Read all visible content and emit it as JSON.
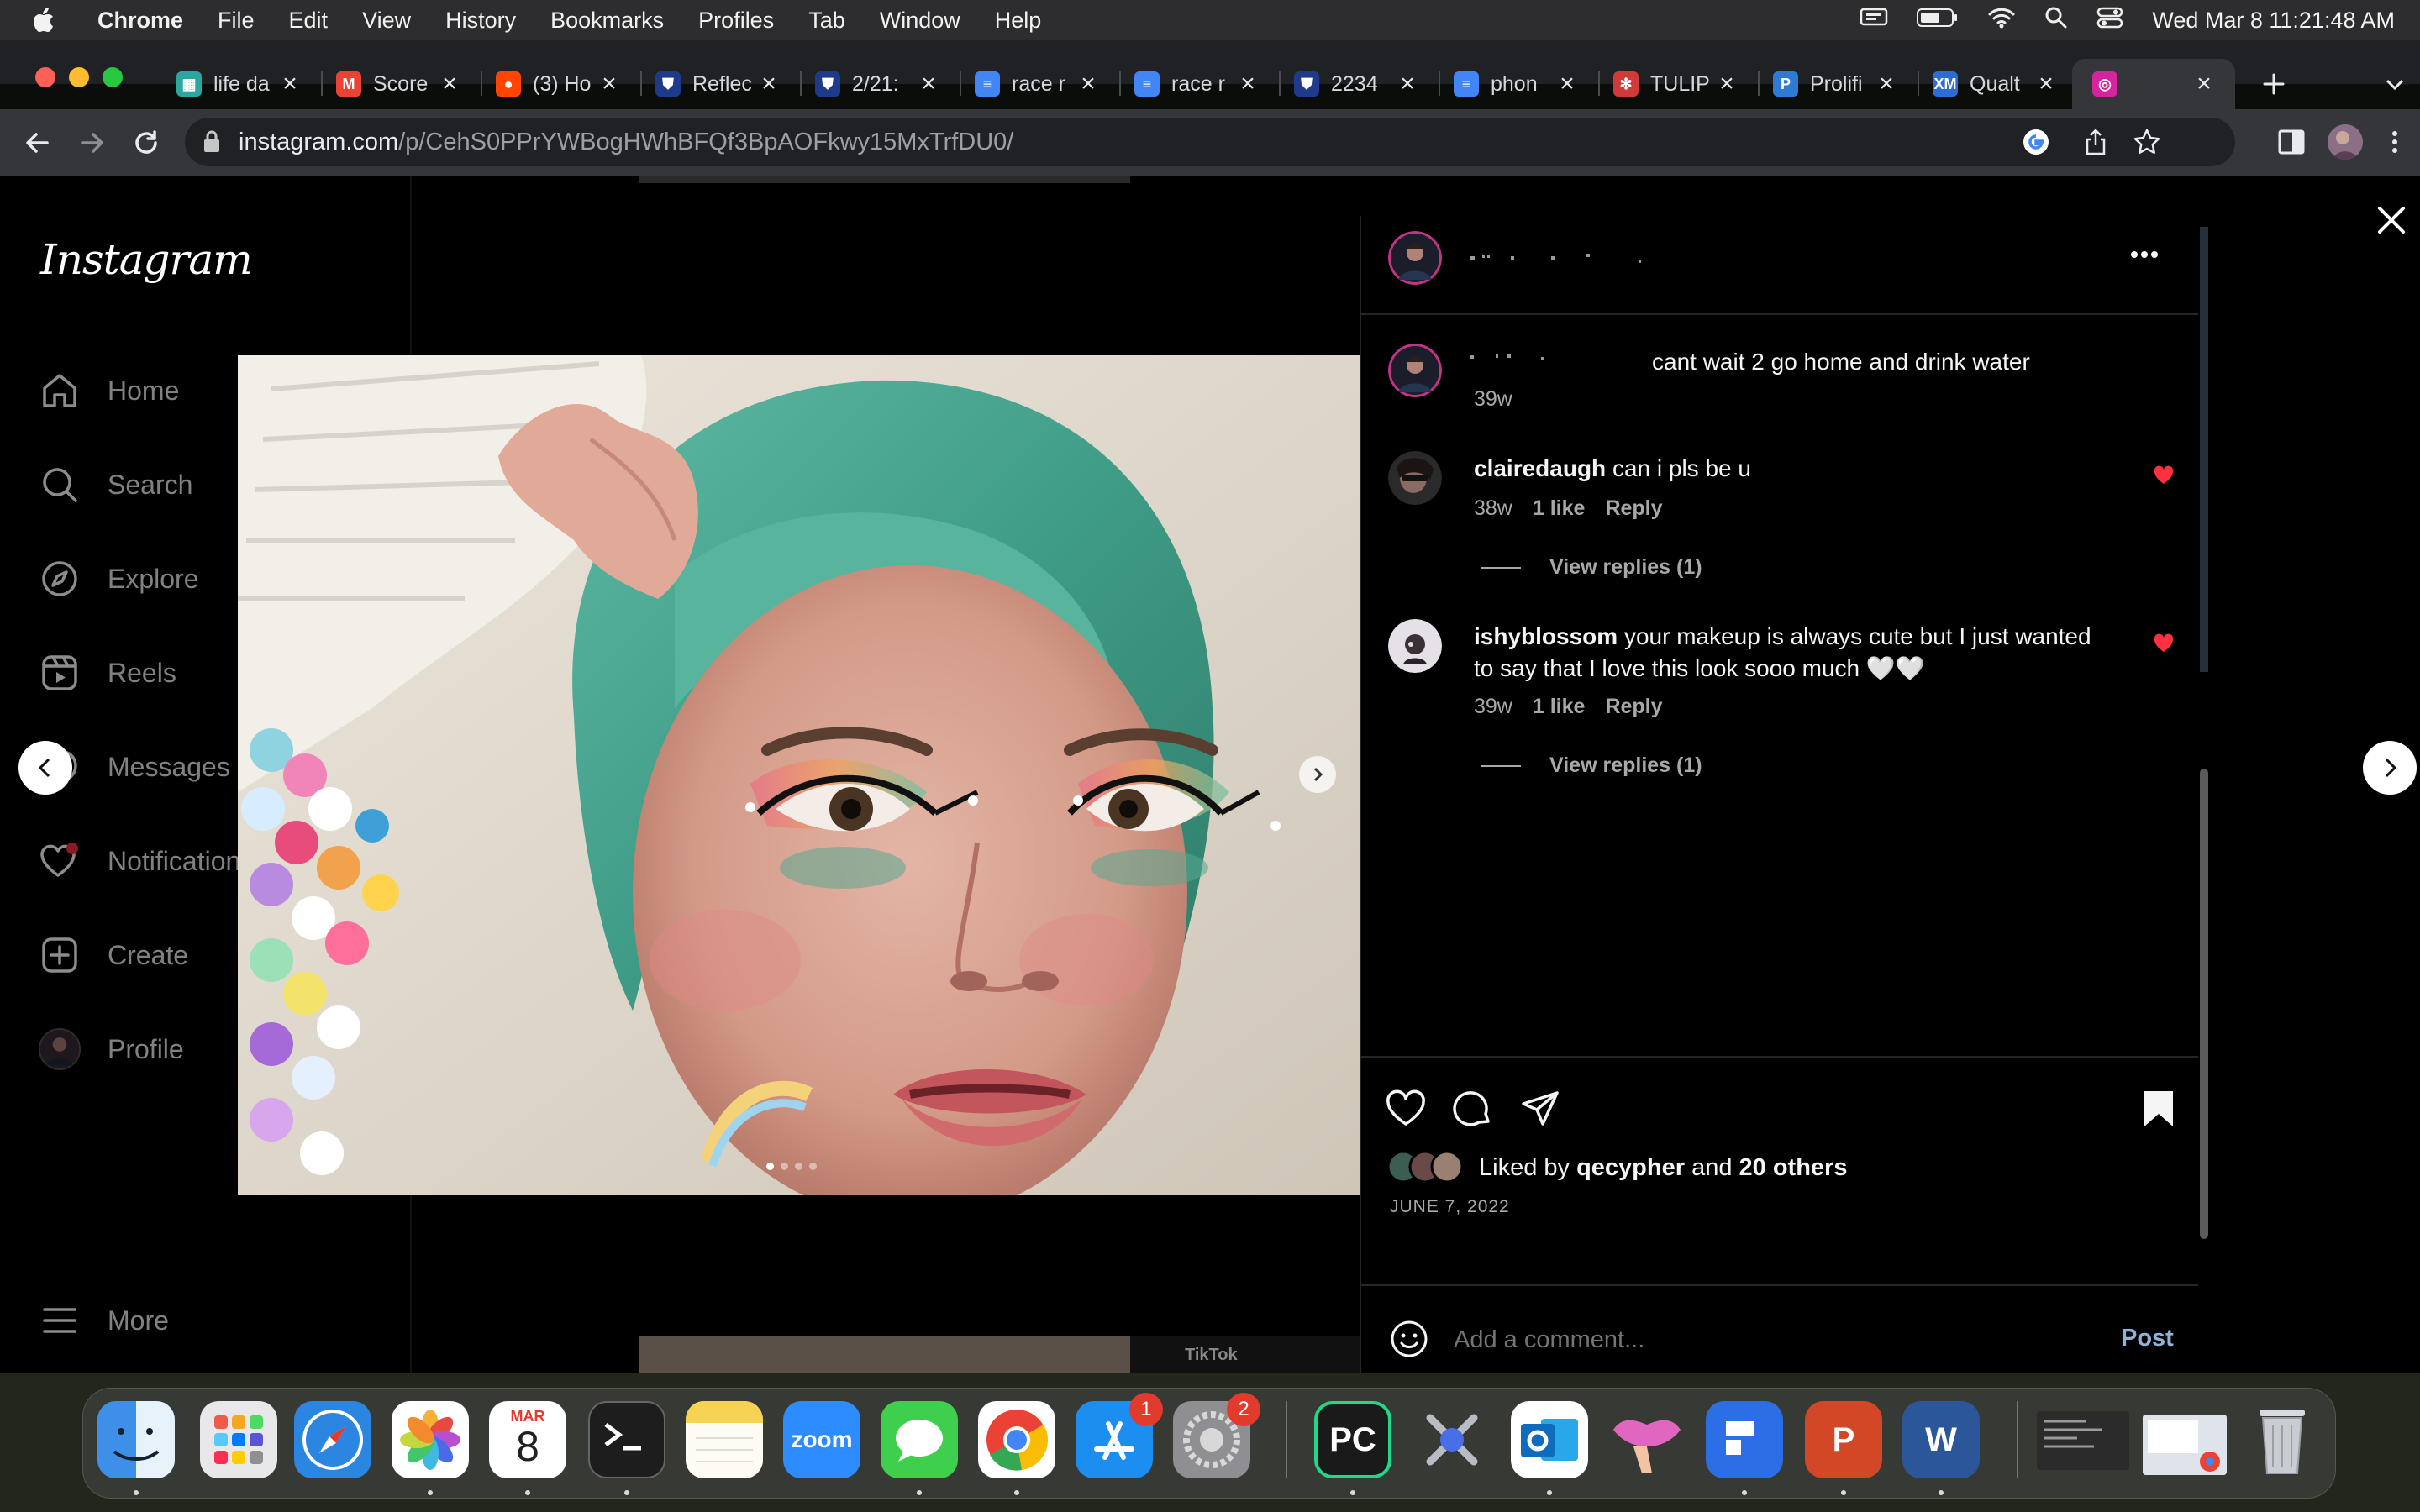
{
  "menubar": {
    "app": "Chrome",
    "items": [
      "File",
      "Edit",
      "View",
      "History",
      "Bookmarks",
      "Profiles",
      "Tab",
      "Window",
      "Help"
    ],
    "clock": "Wed Mar 8  11:21:48 AM"
  },
  "tabs": [
    {
      "label": "life da",
      "icon": "sheets-icon",
      "color": "#2aa8a0"
    },
    {
      "label": "Score",
      "icon": "gmail-icon",
      "color": "#ea4335"
    },
    {
      "label": "(3) Ho",
      "icon": "reddit-icon",
      "color": "#ff4500"
    },
    {
      "label": "Reflec",
      "icon": "shield-icon",
      "color": "#1f3a8a"
    },
    {
      "label": "2/21:",
      "icon": "shield-icon",
      "color": "#1f3a8a"
    },
    {
      "label": "race r",
      "icon": "docs-icon",
      "color": "#4285f4"
    },
    {
      "label": "race r",
      "icon": "docs-icon",
      "color": "#4285f4"
    },
    {
      "label": "2234",
      "icon": "shield-icon",
      "color": "#1f3a8a"
    },
    {
      "label": "phon",
      "icon": "docs-icon",
      "color": "#4285f4"
    },
    {
      "label": "TULIP",
      "icon": "tulip-icon",
      "color": "#d23a3a"
    },
    {
      "label": "Prolifi",
      "icon": "prolific-icon",
      "color": "#2e7bd6"
    },
    {
      "label": "Qualt",
      "icon": "qualtrics-icon",
      "color": "#2d6bd8"
    },
    {
      "label": "",
      "icon": "instagram-icon",
      "color": "#d6249f"
    }
  ],
  "address": {
    "host": "instagram.com",
    "path": "/p/CehS0PPrYWBogHWhBFQf3BpAOFkwy15MxTrfDU0/"
  },
  "instagram": {
    "logo": "Instagram",
    "nav": [
      {
        "label": "Home",
        "icon": "home-icon"
      },
      {
        "label": "Search",
        "icon": "search-icon"
      },
      {
        "label": "Explore",
        "icon": "explore-icon"
      },
      {
        "label": "Reels",
        "icon": "reels-icon"
      },
      {
        "label": "Messages",
        "icon": "messages-icon"
      },
      {
        "label": "Notifications",
        "icon": "heart-icon"
      },
      {
        "label": "Create",
        "icon": "create-icon"
      },
      {
        "label": "Profile",
        "icon": "avatar"
      }
    ],
    "more": "More",
    "post": {
      "caption": "cant wait 2 go home and drink water",
      "caption_time": "39w",
      "comments": [
        {
          "user": "clairedaugh",
          "text": "can i pls be u",
          "time": "38w",
          "likes": "1 like",
          "reply": "Reply",
          "view_replies": "View replies (1)"
        },
        {
          "user": "ishyblossom",
          "text_line1": "your makeup is always cute but I just wanted",
          "text_line2": "to say that I love this look sooo much 🤍🤍",
          "time": "39w",
          "likes": "1 like",
          "reply": "Reply",
          "view_replies": "View replies (1)"
        }
      ],
      "liked_by_prefix": "Liked by ",
      "liked_by_user": "qecypher",
      "liked_by_and": " and ",
      "liked_by_others": "20 others",
      "date": "JUNE 7, 2022",
      "comment_placeholder": "Add a comment...",
      "post_button": "Post",
      "carousel_count": 4,
      "carousel_index": 1
    },
    "tiktok_label": "TikTok"
  },
  "dock": [
    {
      "name": "finder-icon",
      "color": "#3d8fe8"
    },
    {
      "name": "launchpad-icon",
      "color": "#e8e8ea"
    },
    {
      "name": "safari-icon",
      "color": "#2a86e0"
    },
    {
      "name": "photos-icon",
      "color": "#ffffff"
    },
    {
      "name": "calendar-icon",
      "color": "#ffffff",
      "month": "MAR",
      "day": "8"
    },
    {
      "name": "terminal-icon",
      "color": "#1d1d1d"
    },
    {
      "name": "notes-icon",
      "color": "#f7d354"
    },
    {
      "name": "zoom-icon",
      "color": "#2d8cff",
      "label": "zoom"
    },
    {
      "name": "messages-icon",
      "color": "#3ecf4c"
    },
    {
      "name": "chrome-icon",
      "color": "#ffffff"
    },
    {
      "name": "app-store-icon",
      "color": "#1c8ef0",
      "badge": "1"
    },
    {
      "name": "system-settings-icon",
      "color": "#8e8e93",
      "badge": "2"
    },
    {
      "name": "pycharm-icon",
      "color": "#1a1a1a",
      "label": "PC"
    },
    {
      "name": "dev-tools-icon",
      "color": "#6a6a72"
    },
    {
      "name": "outlook-icon",
      "color": "#0f6cbd"
    },
    {
      "name": "lips-app-icon",
      "color": "#d44aa8"
    },
    {
      "name": "wunderlist-icon",
      "color": "#2b6ee6"
    },
    {
      "name": "powerpoint-icon",
      "color": "#d24726",
      "label": "P"
    },
    {
      "name": "word-icon",
      "color": "#2b579a",
      "label": "W"
    },
    {
      "name": "terminal-window-thumb",
      "color": "#2b2b2b"
    },
    {
      "name": "screen-thumb",
      "color": "#dfe4ea"
    },
    {
      "name": "trash-icon",
      "color": "#c9cdd2"
    }
  ]
}
